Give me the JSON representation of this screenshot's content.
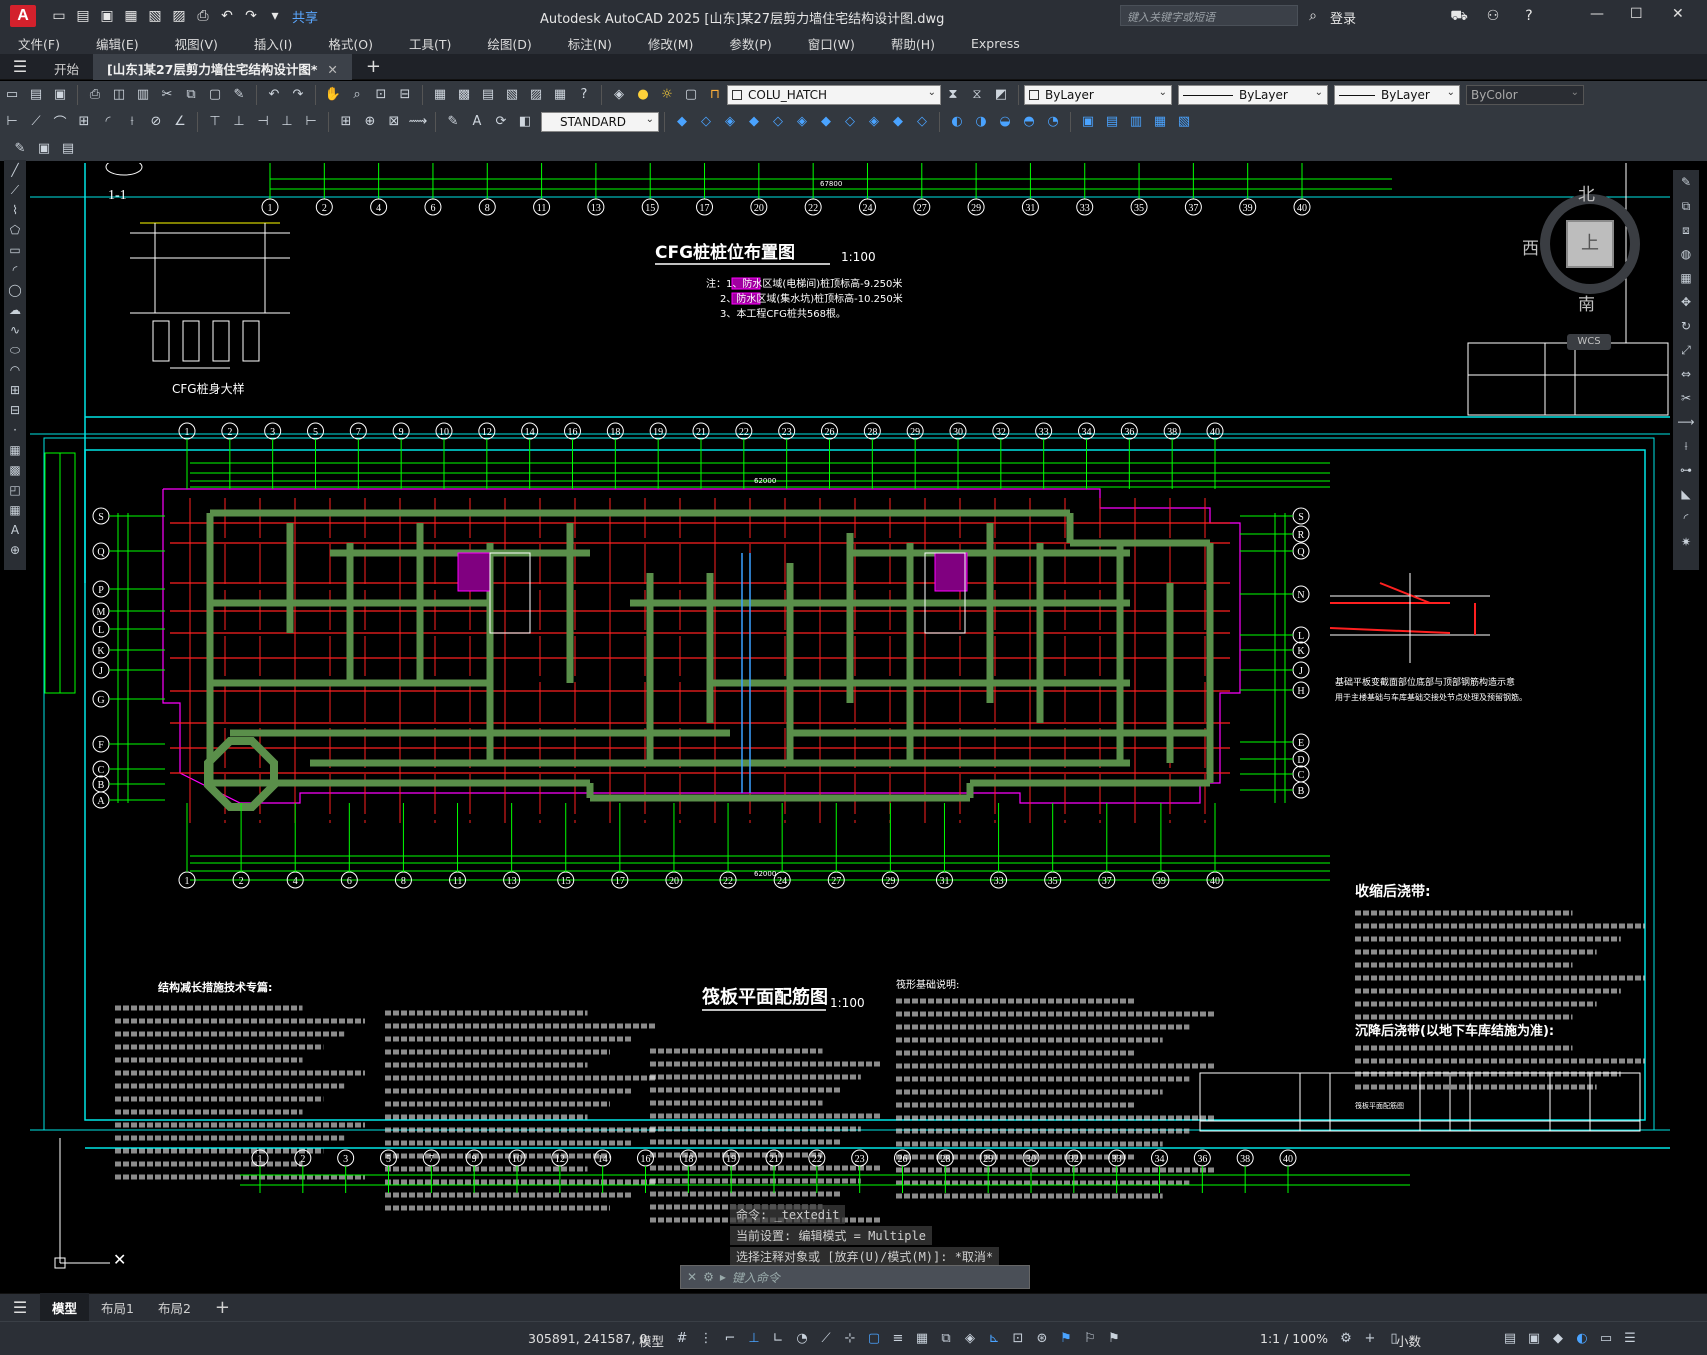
{
  "app": {
    "logo": "A",
    "title": "Autodesk AutoCAD 2025    [山东]某27层剪力墙住宅结构设计图.dwg",
    "share": "共享",
    "search_placeholder": "键入关键字或短语",
    "login": "登录"
  },
  "menu": [
    "文件(F)",
    "编辑(E)",
    "视图(V)",
    "插入(I)",
    "格式(O)",
    "工具(T)",
    "绘图(D)",
    "标注(N)",
    "修改(M)",
    "参数(P)",
    "窗口(W)",
    "帮助(H)",
    "Express"
  ],
  "tabs": {
    "start": "开始",
    "document": "[山东]某27层剪力墙住宅结构设计图*"
  },
  "toolbar": {
    "layer": "COLU_HATCH",
    "color": "ByLayer",
    "linetype": "ByLayer",
    "lineweight": "ByLayer",
    "plotstyle": "ByColor",
    "textstyle": "STANDARD"
  },
  "drawing": {
    "detail_label": "1-1",
    "cfg_detail": "CFG桩身大样",
    "top_title": "CFG桩桩位布置图",
    "top_scale": "1:100",
    "top_notes": [
      "注：1、防水区域(电梯间)桩顶标高-9.250米",
      "2、防水区域(集水坑)桩顶标高-10.250米",
      "3、本工程CFG桩共568根。"
    ],
    "top_total_dim": "67800",
    "main_title": "筏板平面配筋图",
    "main_scale": "1:100",
    "main_total_dim": "62000",
    "top_axes": [
      "1",
      "2",
      "4",
      "6",
      "8",
      "11",
      "13",
      "15",
      "17",
      "20",
      "22",
      "24",
      "27",
      "29",
      "31",
      "33",
      "35",
      "37",
      "39",
      "40"
    ],
    "plan_axes_top": [
      "1",
      "2",
      "3",
      "5",
      "7",
      "9",
      "10",
      "12",
      "14",
      "16",
      "18",
      "19",
      "21",
      "22",
      "23",
      "26",
      "28",
      "29",
      "30",
      "32",
      "33",
      "34",
      "36",
      "38",
      "40"
    ],
    "plan_axes_bottom": [
      "1",
      "2",
      "4",
      "6",
      "8",
      "11",
      "13",
      "15",
      "17",
      "20",
      "22",
      "24",
      "27",
      "29",
      "31",
      "33",
      "35",
      "37",
      "39",
      "40"
    ],
    "plan_axes_left": [
      "S",
      "Q",
      "P",
      "M",
      "L",
      "K",
      "J",
      "G",
      "F",
      "C",
      "B",
      "A"
    ],
    "plan_axes_right": [
      "S",
      "R",
      "Q",
      "N",
      "L",
      "K",
      "J",
      "H",
      "E",
      "D",
      "C",
      "B"
    ],
    "shrink_title": "收缩后浇带:",
    "settle_title": "沉降后浇带(以地下车库结施为准):",
    "notes_title": "结构减长措施技术专篇:",
    "base_notes_title": "筏形基础说明:",
    "callout_note": "基础平板变截面部位底部与顶部钢筋构造示意",
    "callout_subnote": "用于主楼基础与车库基础交接处节点处理及预留钢筋。",
    "title_block_name": "筏板平面配筋图",
    "north": "北",
    "south": "南",
    "west": "西",
    "top_face": "上",
    "wcs": "WCS"
  },
  "command": {
    "history": [
      "命令: _textedit",
      "当前设置: 编辑模式 = Multiple",
      "选择注释对象或 [放弃(U)/模式(M)]: *取消*"
    ],
    "placeholder": "键入命令"
  },
  "layout_tabs": [
    "模型",
    "布局1",
    "布局2"
  ],
  "status": {
    "coords": "305891, 241587, 0",
    "model": "模型",
    "scale": "1:1 / 100%",
    "units": "小数"
  },
  "colors": {
    "cyan": "#00e5e5",
    "green": "#00ff00",
    "red": "#ff2020",
    "magenta": "#ff00ff",
    "wall": "#5a8f4a",
    "white": "#ffffff",
    "yellow": "#ffff00"
  }
}
